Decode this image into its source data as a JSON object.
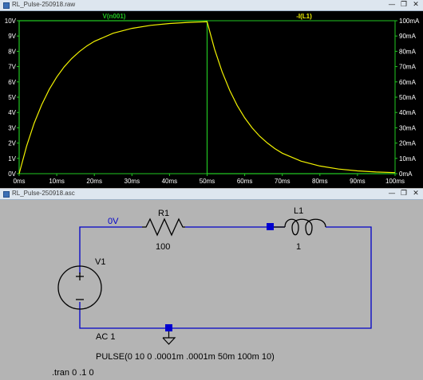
{
  "plot_window": {
    "title": "RL_Pulse-250918.raw",
    "controls": {
      "minimize": "—",
      "restore": "❐",
      "close": "✕"
    }
  },
  "schematic_window": {
    "title": "RL_Pulse-250918.asc",
    "controls": {
      "minimize": "—",
      "restore": "❐",
      "close": "✕"
    }
  },
  "colors": {
    "plot_bg": "#000000",
    "axis_green": "#22c722",
    "trace_yellow": "#f2f200",
    "wire_blue": "#0000c8",
    "schematic_bg": "#b4b4b4"
  },
  "chart_data": {
    "type": "line",
    "x_ticks": [
      "0ms",
      "10ms",
      "20ms",
      "30ms",
      "40ms",
      "50ms",
      "60ms",
      "70ms",
      "80ms",
      "90ms",
      "100ms"
    ],
    "y_left_ticks": [
      "0V",
      "1V",
      "2V",
      "3V",
      "4V",
      "5V",
      "6V",
      "7V",
      "8V",
      "9V",
      "10V"
    ],
    "y_right_ticks": [
      "0mA",
      "10mA",
      "20mA",
      "30mA",
      "40mA",
      "50mA",
      "60mA",
      "70mA",
      "80mA",
      "90mA",
      "100mA"
    ],
    "xlim": [
      0,
      100
    ],
    "ylim_left": [
      0,
      10
    ],
    "ylim_right": [
      0,
      100
    ],
    "grid": false,
    "series": [
      {
        "name": "V(n001)",
        "color": "#22c722",
        "x": [
          0,
          0.0001,
          50,
          50.0001,
          100
        ],
        "y": [
          0,
          10,
          10,
          0,
          0
        ]
      },
      {
        "name": "-I(L1)",
        "color": "#f2f200",
        "x": [
          0,
          2,
          4,
          6,
          8,
          10,
          12,
          14,
          16,
          18,
          20,
          25,
          30,
          35,
          40,
          45,
          50,
          52,
          54,
          56,
          58,
          60,
          62,
          64,
          66,
          68,
          70,
          75,
          80,
          85,
          90,
          95,
          100
        ],
        "y": [
          0,
          18.1,
          33.0,
          45.1,
          55.1,
          63.2,
          69.9,
          75.3,
          79.8,
          83.5,
          86.5,
          91.8,
          95.0,
          97.0,
          98.2,
          98.9,
          99.3,
          81.3,
          66.6,
          54.5,
          44.6,
          36.5,
          29.9,
          24.5,
          20.1,
          16.4,
          13.4,
          8.2,
          5.0,
          3.0,
          1.8,
          1.1,
          0.7
        ]
      }
    ]
  },
  "schematic": {
    "net_label": "0V",
    "r1": {
      "name": "R1",
      "value": "100"
    },
    "l1": {
      "name": "L1",
      "value": "1"
    },
    "v1": {
      "name": "V1",
      "ac": "AC 1",
      "pulse": "PULSE(0 10 0 .0001m .0001m 50m 100m 10)"
    },
    "directive": ".tran 0 .1 0"
  }
}
